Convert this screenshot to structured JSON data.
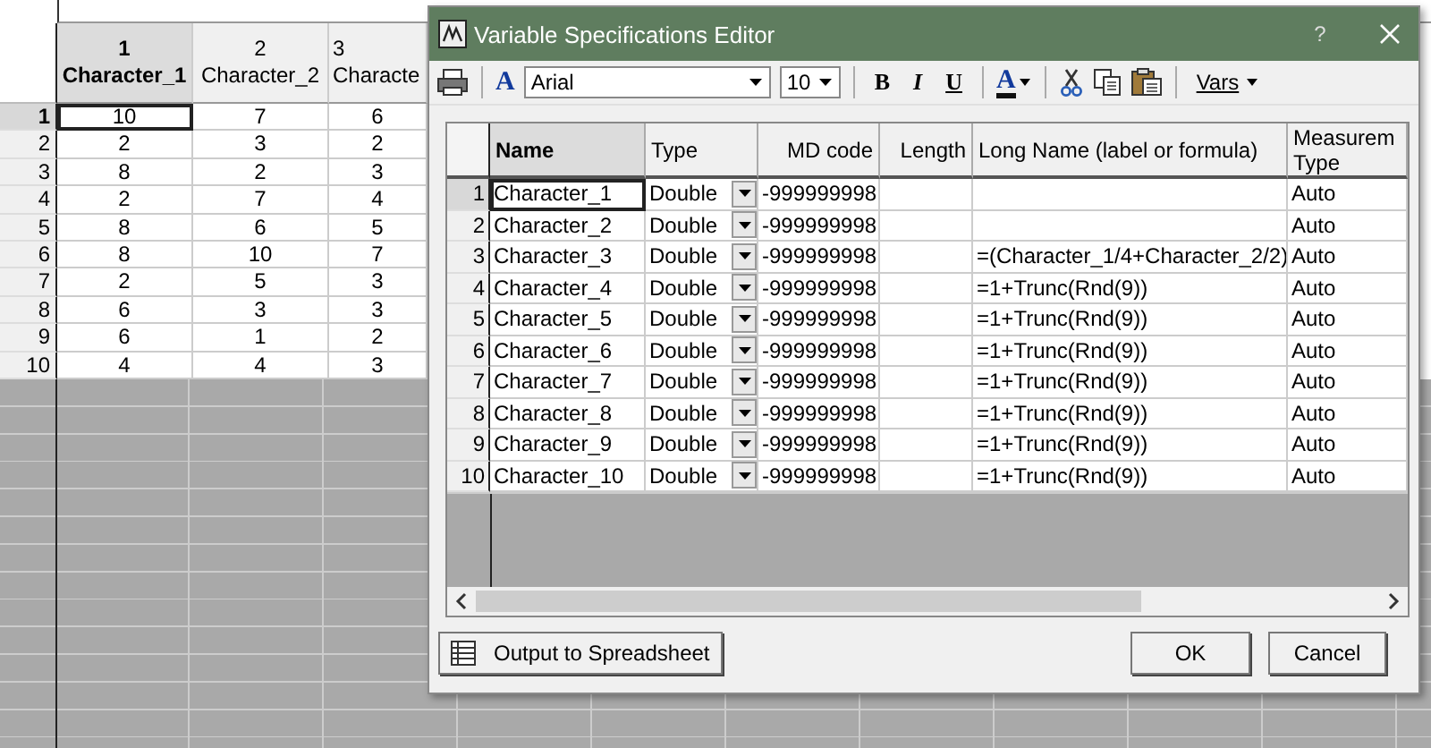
{
  "spreadsheet": {
    "columns": [
      {
        "number": "1",
        "name": "Character_1",
        "selected": true
      },
      {
        "number": "2",
        "name": "Character_2",
        "selected": false
      },
      {
        "number": "3",
        "name": "Characte",
        "selected": false
      }
    ],
    "rows": [
      {
        "label": "1",
        "selected": true,
        "cells": [
          {
            "value": "10",
            "selected": true
          },
          {
            "value": "7",
            "selected": false
          },
          {
            "value": "6",
            "selected": false
          }
        ]
      },
      {
        "label": "2",
        "selected": false,
        "cells": [
          {
            "value": "2",
            "selected": false
          },
          {
            "value": "3",
            "selected": false
          },
          {
            "value": "2",
            "selected": false
          }
        ]
      },
      {
        "label": "3",
        "selected": false,
        "cells": [
          {
            "value": "8",
            "selected": false
          },
          {
            "value": "2",
            "selected": false
          },
          {
            "value": "3",
            "selected": false
          }
        ]
      },
      {
        "label": "4",
        "selected": false,
        "cells": [
          {
            "value": "2",
            "selected": false
          },
          {
            "value": "7",
            "selected": false
          },
          {
            "value": "4",
            "selected": false
          }
        ]
      },
      {
        "label": "5",
        "selected": false,
        "cells": [
          {
            "value": "8",
            "selected": false
          },
          {
            "value": "6",
            "selected": false
          },
          {
            "value": "5",
            "selected": false
          }
        ]
      },
      {
        "label": "6",
        "selected": false,
        "cells": [
          {
            "value": "8",
            "selected": false
          },
          {
            "value": "10",
            "selected": false
          },
          {
            "value": "7",
            "selected": false
          }
        ]
      },
      {
        "label": "7",
        "selected": false,
        "cells": [
          {
            "value": "2",
            "selected": false
          },
          {
            "value": "5",
            "selected": false
          },
          {
            "value": "3",
            "selected": false
          }
        ]
      },
      {
        "label": "8",
        "selected": false,
        "cells": [
          {
            "value": "6",
            "selected": false
          },
          {
            "value": "3",
            "selected": false
          },
          {
            "value": "3",
            "selected": false
          }
        ]
      },
      {
        "label": "9",
        "selected": false,
        "cells": [
          {
            "value": "6",
            "selected": false
          },
          {
            "value": "1",
            "selected": false
          },
          {
            "value": "2",
            "selected": false
          }
        ]
      },
      {
        "label": "10",
        "selected": false,
        "cells": [
          {
            "value": "4",
            "selected": false
          },
          {
            "value": "4",
            "selected": false
          },
          {
            "value": "3",
            "selected": false
          }
        ]
      }
    ]
  },
  "dialog": {
    "title": "Variable Specifications Editor",
    "help": "?",
    "toolbar": {
      "font_glyph": "A",
      "font": "Arial",
      "size": "10",
      "bold": "B",
      "italic": "I",
      "underline": "U",
      "color_glyph": "A",
      "vars": "Vars"
    },
    "columns": [
      "Name",
      "Type",
      "MD code",
      "Length",
      "Long Name (label or formula)",
      "Measurem Type"
    ],
    "rows": [
      {
        "label": "1",
        "name": "Character_1",
        "type": "Double",
        "md_code": "-999999998",
        "measurement_type": "Auto",
        "selected": true
      },
      {
        "label": "2",
        "name": "Character_2",
        "type": "Double",
        "md_code": "-999999998",
        "measurement_type": "Auto",
        "selected": false
      },
      {
        "label": "3",
        "name": "Character_3",
        "type": "Double",
        "md_code": "-999999998",
        "long_name": "=(Character_1/4+Character_2/2)",
        "measurement_type": "Auto",
        "selected": false
      },
      {
        "label": "4",
        "name": "Character_4",
        "type": "Double",
        "md_code": "-999999998",
        "long_name": "=1+Trunc(Rnd(9))",
        "measurement_type": "Auto",
        "selected": false
      },
      {
        "label": "5",
        "name": "Character_5",
        "type": "Double",
        "md_code": "-999999998",
        "long_name": "=1+Trunc(Rnd(9))",
        "measurement_type": "Auto",
        "selected": false
      },
      {
        "label": "6",
        "name": "Character_6",
        "type": "Double",
        "md_code": "-999999998",
        "long_name": "=1+Trunc(Rnd(9))",
        "measurement_type": "Auto",
        "selected": false
      },
      {
        "label": "7",
        "name": "Character_7",
        "type": "Double",
        "md_code": "-999999998",
        "long_name": "=1+Trunc(Rnd(9))",
        "measurement_type": "Auto",
        "selected": false
      },
      {
        "label": "8",
        "name": "Character_8",
        "type": "Double",
        "md_code": "-999999998",
        "long_name": "=1+Trunc(Rnd(9))",
        "measurement_type": "Auto",
        "selected": false
      },
      {
        "label": "9",
        "name": "Character_9",
        "type": "Double",
        "md_code": "-999999998",
        "long_name": "=1+Trunc(Rnd(9))",
        "measurement_type": "Auto",
        "selected": false
      },
      {
        "label": "10",
        "name": "Character_10",
        "type": "Double",
        "md_code": "-999999998",
        "long_name": "=1+Trunc(Rnd(9))",
        "measurement_type": "Auto",
        "selected": false
      }
    ],
    "buttons": {
      "output": "Output to Spreadsheet",
      "ok": "OK",
      "cancel": "Cancel"
    }
  }
}
